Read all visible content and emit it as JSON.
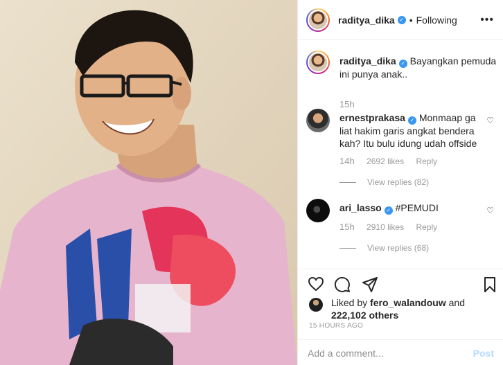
{
  "post": {
    "photo_alt": "photo",
    "header": {
      "username": "raditya_dika",
      "separator": "•",
      "follow_status": "Following",
      "more": "•••"
    },
    "caption": {
      "username": "raditya_dika",
      "text": "Bayangkan pemuda ini punya anak..",
      "time": "15h"
    },
    "comments": [
      {
        "username": "ernestprakasa",
        "text": "Monmaap ga liat hakim garis angkat bendera kah? Itu bulu idung udah offside",
        "time": "14h",
        "likes": "2692 likes",
        "reply": "Reply",
        "view_replies": "View replies (82)"
      },
      {
        "username": "ari_lasso",
        "text": "#PEMUDI",
        "time": "15h",
        "likes": "2910 likes",
        "reply": "Reply",
        "view_replies": "View replies (68)"
      }
    ],
    "liked_by": {
      "prefix": "Liked by ",
      "user": "fero_walandouw",
      "suffix": " and",
      "count": "222,102 others"
    },
    "time_ago": "15 HOURS AGO",
    "add_comment": {
      "placeholder": "Add a comment...",
      "post_label": "Post"
    },
    "icons": [
      "heart-icon",
      "comment-icon",
      "share-icon",
      "bookmark-icon",
      "verified-badge-icon"
    ],
    "colors": {
      "verified": "#3897f0",
      "muted": "#999999",
      "post_disabled": "#b3dbff",
      "shirt": "#e8b8d0"
    }
  }
}
